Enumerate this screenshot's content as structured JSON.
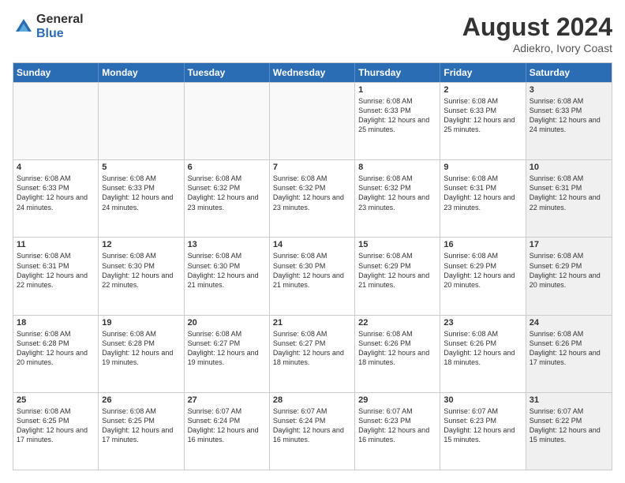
{
  "header": {
    "logo_general": "General",
    "logo_blue": "Blue",
    "title": "August 2024",
    "location": "Adiekro, Ivory Coast"
  },
  "days_of_week": [
    "Sunday",
    "Monday",
    "Tuesday",
    "Wednesday",
    "Thursday",
    "Friday",
    "Saturday"
  ],
  "weeks": [
    [
      {
        "day": "",
        "info": "",
        "empty": true
      },
      {
        "day": "",
        "info": "",
        "empty": true
      },
      {
        "day": "",
        "info": "",
        "empty": true
      },
      {
        "day": "",
        "info": "",
        "empty": true
      },
      {
        "day": "1",
        "info": "Sunrise: 6:08 AM\nSunset: 6:33 PM\nDaylight: 12 hours\nand 25 minutes.",
        "empty": false
      },
      {
        "day": "2",
        "info": "Sunrise: 6:08 AM\nSunset: 6:33 PM\nDaylight: 12 hours\nand 25 minutes.",
        "empty": false
      },
      {
        "day": "3",
        "info": "Sunrise: 6:08 AM\nSunset: 6:33 PM\nDaylight: 12 hours\nand 24 minutes.",
        "empty": false,
        "shaded": true
      }
    ],
    [
      {
        "day": "4",
        "info": "Sunrise: 6:08 AM\nSunset: 6:33 PM\nDaylight: 12 hours\nand 24 minutes.",
        "empty": false
      },
      {
        "day": "5",
        "info": "Sunrise: 6:08 AM\nSunset: 6:33 PM\nDaylight: 12 hours\nand 24 minutes.",
        "empty": false
      },
      {
        "day": "6",
        "info": "Sunrise: 6:08 AM\nSunset: 6:32 PM\nDaylight: 12 hours\nand 23 minutes.",
        "empty": false
      },
      {
        "day": "7",
        "info": "Sunrise: 6:08 AM\nSunset: 6:32 PM\nDaylight: 12 hours\nand 23 minutes.",
        "empty": false
      },
      {
        "day": "8",
        "info": "Sunrise: 6:08 AM\nSunset: 6:32 PM\nDaylight: 12 hours\nand 23 minutes.",
        "empty": false
      },
      {
        "day": "9",
        "info": "Sunrise: 6:08 AM\nSunset: 6:31 PM\nDaylight: 12 hours\nand 23 minutes.",
        "empty": false
      },
      {
        "day": "10",
        "info": "Sunrise: 6:08 AM\nSunset: 6:31 PM\nDaylight: 12 hours\nand 22 minutes.",
        "empty": false,
        "shaded": true
      }
    ],
    [
      {
        "day": "11",
        "info": "Sunrise: 6:08 AM\nSunset: 6:31 PM\nDaylight: 12 hours\nand 22 minutes.",
        "empty": false
      },
      {
        "day": "12",
        "info": "Sunrise: 6:08 AM\nSunset: 6:30 PM\nDaylight: 12 hours\nand 22 minutes.",
        "empty": false
      },
      {
        "day": "13",
        "info": "Sunrise: 6:08 AM\nSunset: 6:30 PM\nDaylight: 12 hours\nand 21 minutes.",
        "empty": false
      },
      {
        "day": "14",
        "info": "Sunrise: 6:08 AM\nSunset: 6:30 PM\nDaylight: 12 hours\nand 21 minutes.",
        "empty": false
      },
      {
        "day": "15",
        "info": "Sunrise: 6:08 AM\nSunset: 6:29 PM\nDaylight: 12 hours\nand 21 minutes.",
        "empty": false
      },
      {
        "day": "16",
        "info": "Sunrise: 6:08 AM\nSunset: 6:29 PM\nDaylight: 12 hours\nand 20 minutes.",
        "empty": false
      },
      {
        "day": "17",
        "info": "Sunrise: 6:08 AM\nSunset: 6:29 PM\nDaylight: 12 hours\nand 20 minutes.",
        "empty": false,
        "shaded": true
      }
    ],
    [
      {
        "day": "18",
        "info": "Sunrise: 6:08 AM\nSunset: 6:28 PM\nDaylight: 12 hours\nand 20 minutes.",
        "empty": false
      },
      {
        "day": "19",
        "info": "Sunrise: 6:08 AM\nSunset: 6:28 PM\nDaylight: 12 hours\nand 19 minutes.",
        "empty": false
      },
      {
        "day": "20",
        "info": "Sunrise: 6:08 AM\nSunset: 6:27 PM\nDaylight: 12 hours\nand 19 minutes.",
        "empty": false
      },
      {
        "day": "21",
        "info": "Sunrise: 6:08 AM\nSunset: 6:27 PM\nDaylight: 12 hours\nand 18 minutes.",
        "empty": false
      },
      {
        "day": "22",
        "info": "Sunrise: 6:08 AM\nSunset: 6:26 PM\nDaylight: 12 hours\nand 18 minutes.",
        "empty": false
      },
      {
        "day": "23",
        "info": "Sunrise: 6:08 AM\nSunset: 6:26 PM\nDaylight: 12 hours\nand 18 minutes.",
        "empty": false
      },
      {
        "day": "24",
        "info": "Sunrise: 6:08 AM\nSunset: 6:26 PM\nDaylight: 12 hours\nand 17 minutes.",
        "empty": false,
        "shaded": true
      }
    ],
    [
      {
        "day": "25",
        "info": "Sunrise: 6:08 AM\nSunset: 6:25 PM\nDaylight: 12 hours\nand 17 minutes.",
        "empty": false
      },
      {
        "day": "26",
        "info": "Sunrise: 6:08 AM\nSunset: 6:25 PM\nDaylight: 12 hours\nand 17 minutes.",
        "empty": false
      },
      {
        "day": "27",
        "info": "Sunrise: 6:07 AM\nSunset: 6:24 PM\nDaylight: 12 hours\nand 16 minutes.",
        "empty": false
      },
      {
        "day": "28",
        "info": "Sunrise: 6:07 AM\nSunset: 6:24 PM\nDaylight: 12 hours\nand 16 minutes.",
        "empty": false
      },
      {
        "day": "29",
        "info": "Sunrise: 6:07 AM\nSunset: 6:23 PM\nDaylight: 12 hours\nand 16 minutes.",
        "empty": false
      },
      {
        "day": "30",
        "info": "Sunrise: 6:07 AM\nSunset: 6:23 PM\nDaylight: 12 hours\nand 15 minutes.",
        "empty": false
      },
      {
        "day": "31",
        "info": "Sunrise: 6:07 AM\nSunset: 6:22 PM\nDaylight: 12 hours\nand 15 minutes.",
        "empty": false,
        "shaded": true
      }
    ]
  ]
}
